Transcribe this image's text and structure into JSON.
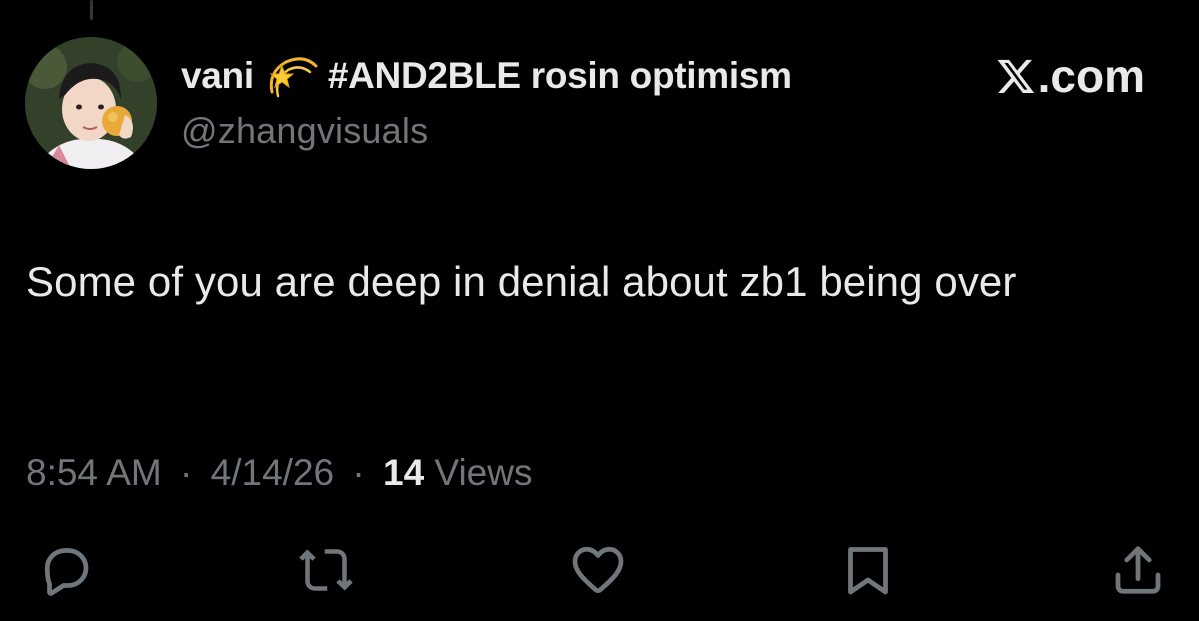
{
  "author": {
    "display_name": "vani",
    "name_tag": "#AND2BLE rosin optimism",
    "handle": "@zhangvisuals",
    "emoji_icon": "dizzy-star-emoji"
  },
  "brand": {
    "text": ".com",
    "logo_icon": "x-logo-icon"
  },
  "tweet": {
    "text": "Some of you are deep in denial about zb1 being over",
    "time": "8:54 AM",
    "separator_1": "·",
    "date": "4/14/26",
    "separator_2": "·",
    "views_count": "14",
    "views_label": "Views"
  },
  "actions": [
    {
      "name": "reply",
      "icon": "reply-icon"
    },
    {
      "name": "repost",
      "icon": "repost-icon"
    },
    {
      "name": "like",
      "icon": "heart-icon"
    },
    {
      "name": "bookmark",
      "icon": "bookmark-icon"
    },
    {
      "name": "share",
      "icon": "share-icon"
    }
  ],
  "colors": {
    "background": "#000000",
    "primary_text": "#e7e9ea",
    "secondary_text": "#71767b",
    "thread_line": "#333639"
  }
}
